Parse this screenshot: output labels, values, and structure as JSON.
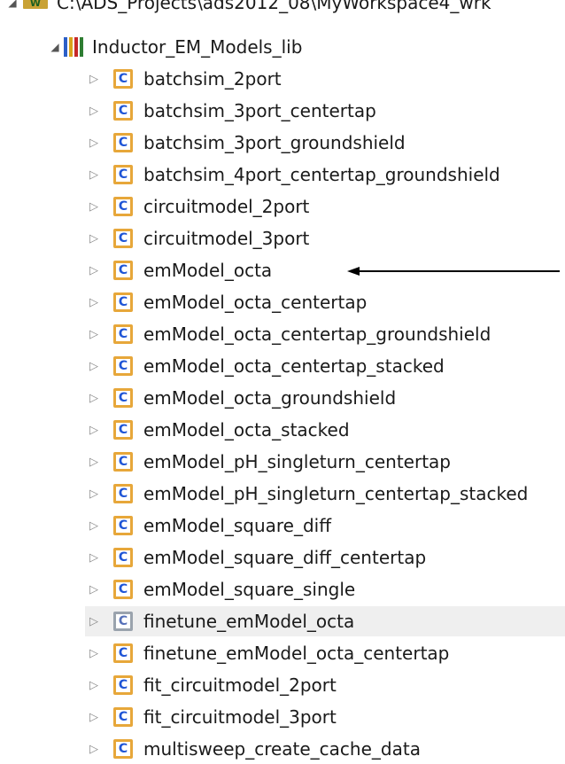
{
  "tree": {
    "workspace": {
      "path": "C:\\ADS_Projects\\ads2012_08\\MyWorkspace4_wrk",
      "icon": "workspace-icon"
    },
    "library": {
      "label": "Inductor_EM_Models_lib",
      "icon": "library-icon"
    },
    "cells": [
      {
        "label": "batchsim_2port"
      },
      {
        "label": "batchsim_3port_centertap"
      },
      {
        "label": "batchsim_3port_groundshield"
      },
      {
        "label": "batchsim_4port_centertap_groundshield"
      },
      {
        "label": "circuitmodel_2port"
      },
      {
        "label": "circuitmodel_3port"
      },
      {
        "label": "emModel_octa"
      },
      {
        "label": "emModel_octa_centertap"
      },
      {
        "label": "emModel_octa_centertap_groundshield"
      },
      {
        "label": "emModel_octa_centertap_stacked"
      },
      {
        "label": "emModel_octa_groundshield"
      },
      {
        "label": "emModel_octa_stacked"
      },
      {
        "label": "emModel_pH_singleturn_centertap"
      },
      {
        "label": "emModel_pH_singleturn_centertap_stacked"
      },
      {
        "label": "emModel_square_diff"
      },
      {
        "label": "emModel_square_diff_centertap"
      },
      {
        "label": "emModel_square_single"
      },
      {
        "label": "finetune_emModel_octa"
      },
      {
        "label": "finetune_emModel_octa_centertap"
      },
      {
        "label": "fit_circuitmodel_2port"
      },
      {
        "label": "fit_circuitmodel_3port"
      },
      {
        "label": "multisweep_create_cache_data"
      }
    ],
    "cell_icon_letter": "C",
    "expanded_glyph": "◢",
    "collapsed_glyph": "▷"
  },
  "colors": {
    "folder_border": "#e7a73a",
    "cell_letter": "#1f55d6",
    "selected_row": "#efefef"
  }
}
